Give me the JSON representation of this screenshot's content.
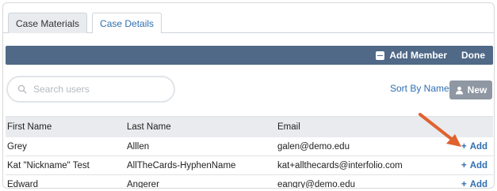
{
  "tabs": [
    {
      "label": "Case Materials",
      "active": false
    },
    {
      "label": "Case Details",
      "active": true
    }
  ],
  "toolbar": {
    "add_member_label": "Add Member",
    "done_label": "Done",
    "bar_color": "#4f6987"
  },
  "search": {
    "placeholder": "Search users"
  },
  "sort": {
    "label": "Sort By Name"
  },
  "new_button": {
    "label": "New"
  },
  "table": {
    "headers": [
      "First Name",
      "Last Name",
      "Email"
    ],
    "rows": [
      {
        "first": "Grey",
        "last": "Alllen",
        "email": "galen@demo.edu",
        "action": "Add"
      },
      {
        "first": "Kat \"Nickname\" Test",
        "last": "AllTheCards-HyphenName",
        "email": "kat+allthecards@interfolio.com",
        "action": "Add"
      },
      {
        "first": "Edward",
        "last": "Angerer",
        "email": "eangry@demo.edu",
        "action": "Add"
      }
    ]
  },
  "colors": {
    "accent": "#2f6fb0",
    "annotation_arrow": "#e0622e"
  },
  "icons": {
    "search": "search-icon",
    "sort": "chevron-down-icon",
    "new": "user-icon",
    "add_member": "minus-square-icon",
    "add": "plus-icon"
  }
}
